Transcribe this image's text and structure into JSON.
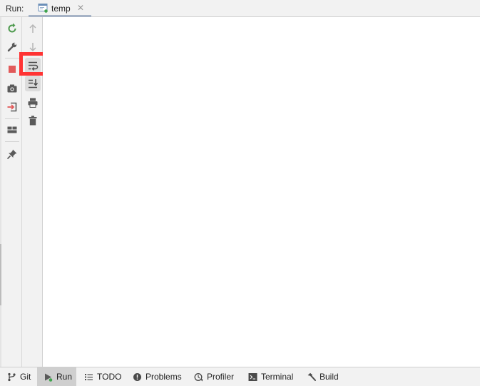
{
  "header": {
    "run_label": "Run:",
    "tab_label": "temp",
    "tab_close": "✕"
  },
  "bottom_tabs": [
    {
      "label": "Git",
      "icon": "branch-icon"
    },
    {
      "label": "Run",
      "icon": "run-play-icon",
      "active": true
    },
    {
      "label": "TODO",
      "icon": "list-icon"
    },
    {
      "label": "Problems",
      "icon": "problems-icon"
    },
    {
      "label": "Profiler",
      "icon": "profiler-icon"
    },
    {
      "label": "Terminal",
      "icon": "terminal-icon"
    },
    {
      "label": "Build",
      "icon": "hammer-icon"
    }
  ],
  "colors": {
    "accent_green": "#4e9a4e",
    "stop_red": "#e15a5a",
    "highlight": "#ff3333"
  }
}
